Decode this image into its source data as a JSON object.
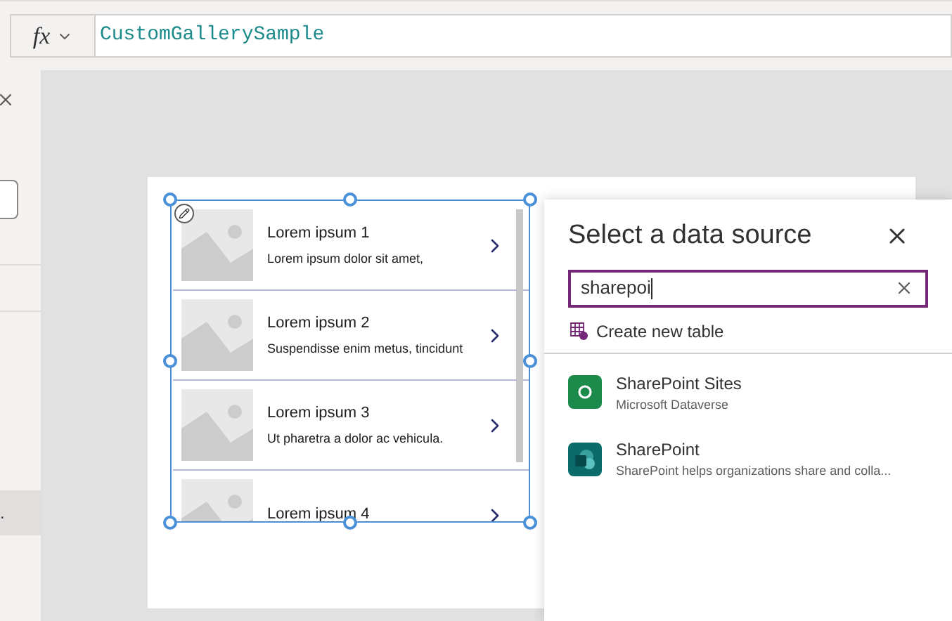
{
  "formula_bar": {
    "function_label": "fx",
    "formula": "CustomGallerySample"
  },
  "left_panel": {
    "truncated_item": "."
  },
  "gallery": {
    "items": [
      {
        "title": "Lorem ipsum 1",
        "subtitle": "Lorem ipsum dolor sit amet,"
      },
      {
        "title": "Lorem ipsum 2",
        "subtitle": "Suspendisse enim metus, tincidunt"
      },
      {
        "title": "Lorem ipsum 3",
        "subtitle": "Ut pharetra a dolor ac vehicula."
      },
      {
        "title": "Lorem ipsum 4"
      }
    ]
  },
  "data_source_panel": {
    "title": "Select a data source",
    "search": {
      "value": "sharepoi"
    },
    "create_action": "Create new table",
    "sources": [
      {
        "kind": "dataverse",
        "name": "SharePoint Sites",
        "description": "Microsoft Dataverse"
      },
      {
        "kind": "sharepoint",
        "name": "SharePoint",
        "description": "SharePoint helps organizations share and colla..."
      }
    ]
  }
}
